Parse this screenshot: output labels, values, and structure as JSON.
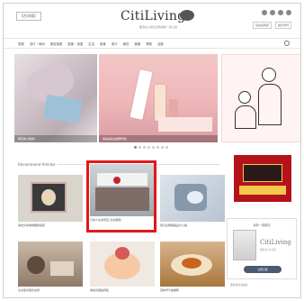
{
  "header": {
    "site_tag": "【台灣版】",
    "logo_text": "CitiLiving",
    "tagline": "都會女子的生活情報誌・線上版",
    "links": [
      "寫給編輯部",
      "關於我們"
    ]
  },
  "nav": {
    "items": [
      "首頁",
      "流行・時尚",
      "美容保養",
      "健康・減重",
      "生活",
      "美食",
      "旅行",
      "兩性",
      "娛樂",
      "專題",
      "活動"
    ]
  },
  "hero": {
    "left_caption": "每天的小確幸！",
    "mid_caption": "保養品新品推薦特集",
    "right_caption": ""
  },
  "section": {
    "title": "Recommend Articles"
  },
  "cards": [
    {
      "caption": "探訪文青咖啡廳的秘密"
    },
    {
      "caption": "日本人氣壽司店 台北開幕！"
    },
    {
      "caption": "夏日必備保養品大公開"
    },
    {
      "caption": "台北夜市美食巡禮"
    },
    {
      "caption": "療癒系甜點特集"
    },
    {
      "caption": "週末早午餐推薦"
    }
  ],
  "sidebar": {
    "box_title": "最新一期雜誌",
    "logo_text": "CitiLiving",
    "sub": "都會女子生活誌",
    "button": "立即訂閱",
    "note": "更多資訊請點此"
  },
  "colors": {
    "highlight": "#e0181b",
    "accent": "#b5121b",
    "button": "#4a5a70"
  }
}
